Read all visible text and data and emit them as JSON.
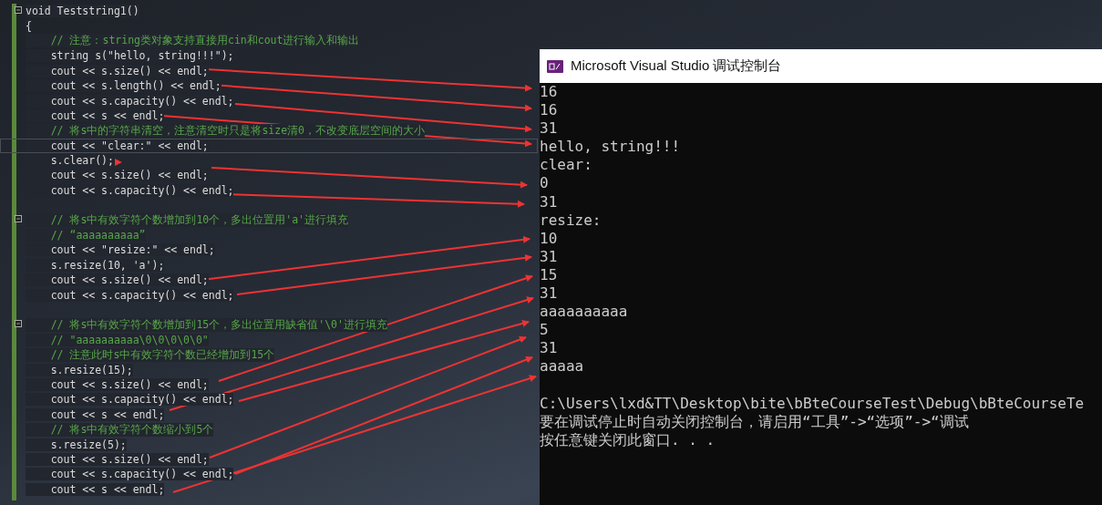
{
  "editor": {
    "lines": [
      {
        "kind": "code",
        "text": "void Teststring1()",
        "fold": true,
        "current": false
      },
      {
        "kind": "code",
        "text": "{",
        "fold": false,
        "current": false
      },
      {
        "kind": "comment",
        "text": "    // 注意：string类对象支持直接用cin和cout进行输入和输出",
        "fold": false,
        "current": false
      },
      {
        "kind": "code",
        "text": "    string s(\"hello, string!!!\");",
        "fold": false,
        "current": false
      },
      {
        "kind": "code",
        "text": "    cout << s.size() << endl;",
        "fold": false,
        "current": false
      },
      {
        "kind": "code",
        "text": "    cout << s.length() << endl;",
        "fold": false,
        "current": false
      },
      {
        "kind": "code",
        "text": "    cout << s.capacity() << endl;",
        "fold": false,
        "current": false
      },
      {
        "kind": "code",
        "text": "    cout << s << endl;",
        "fold": false,
        "current": false
      },
      {
        "kind": "comment",
        "text": "    // 将s中的字符串清空，注意清空时只是将size清0，不改变底层空间的大小",
        "fold": false,
        "current": false
      },
      {
        "kind": "code",
        "text": "    cout << \"clear:\" << endl;",
        "fold": false,
        "current": true
      },
      {
        "kind": "code",
        "text": "    s.clear();",
        "fold": false,
        "current": false
      },
      {
        "kind": "code",
        "text": "    cout << s.size() << endl;",
        "fold": false,
        "current": false
      },
      {
        "kind": "code",
        "text": "    cout << s.capacity() << endl;",
        "fold": false,
        "current": false
      },
      {
        "kind": "blank",
        "fold": false,
        "current": false
      },
      {
        "kind": "comment",
        "text": "    // 将s中有效字符个数增加到10个，多出位置用'a'进行填充",
        "fold": true,
        "current": false
      },
      {
        "kind": "comment",
        "text": "    // “aaaaaaaaaa”",
        "fold": false,
        "current": false
      },
      {
        "kind": "code",
        "text": "    cout << \"resize:\" << endl;",
        "fold": false,
        "current": false
      },
      {
        "kind": "code",
        "text": "    s.resize(10, 'a');",
        "fold": false,
        "current": false
      },
      {
        "kind": "code",
        "text": "    cout << s.size() << endl;",
        "fold": false,
        "current": false
      },
      {
        "kind": "code",
        "text": "    cout << s.capacity() << endl;",
        "fold": false,
        "current": false
      },
      {
        "kind": "blank",
        "fold": false,
        "current": false
      },
      {
        "kind": "comment",
        "text": "    // 将s中有效字符个数增加到15个，多出位置用缺省值'\\0'进行填充",
        "fold": true,
        "current": false
      },
      {
        "kind": "comment",
        "text": "    // \"aaaaaaaaaa\\0\\0\\0\\0\\0\"",
        "fold": false,
        "current": false
      },
      {
        "kind": "comment",
        "text": "    // 注意此时s中有效字符个数已经增加到15个",
        "fold": false,
        "current": false
      },
      {
        "kind": "code",
        "text": "    s.resize(15);",
        "fold": false,
        "current": false
      },
      {
        "kind": "code",
        "text": "    cout << s.size() << endl;",
        "fold": false,
        "current": false
      },
      {
        "kind": "code",
        "text": "    cout << s.capacity() << endl;",
        "fold": false,
        "current": false
      },
      {
        "kind": "code",
        "text": "    cout << s << endl;",
        "fold": false,
        "current": false
      },
      {
        "kind": "comment",
        "text": "    // 将s中有效字符个数缩小到5个",
        "fold": false,
        "current": false
      },
      {
        "kind": "code",
        "text": "    s.resize(5);",
        "fold": false,
        "current": false
      },
      {
        "kind": "code",
        "text": "    cout << s.size() << endl;",
        "fold": false,
        "current": false
      },
      {
        "kind": "code",
        "text": "    cout << s.capacity() << endl;",
        "fold": false,
        "current": false
      },
      {
        "kind": "code",
        "text": "    cout << s << endl;",
        "fold": false,
        "current": false
      }
    ]
  },
  "console": {
    "title": "Microsoft Visual Studio 调试控制台",
    "lines": [
      {
        "kind": "text",
        "text": "16"
      },
      {
        "kind": "text",
        "text": "16"
      },
      {
        "kind": "text",
        "text": "31"
      },
      {
        "kind": "text",
        "text": "hello, string!!!"
      },
      {
        "kind": "text",
        "text": "clear:"
      },
      {
        "kind": "text",
        "text": "0"
      },
      {
        "kind": "text",
        "text": "31"
      },
      {
        "kind": "text",
        "text": "resize:"
      },
      {
        "kind": "text",
        "text": "10"
      },
      {
        "kind": "text",
        "text": "31"
      },
      {
        "kind": "text",
        "text": "15"
      },
      {
        "kind": "text",
        "text": "31"
      },
      {
        "kind": "text",
        "text": "aaaaaaaaaa"
      },
      {
        "kind": "text",
        "text": "5"
      },
      {
        "kind": "text",
        "text": "31"
      },
      {
        "kind": "text",
        "text": "aaaaa"
      },
      {
        "kind": "blank"
      },
      {
        "kind": "text",
        "text": "C:\\Users\\lxd&TT\\Desktop\\bite\\bBteCourseTest\\Debug\\bBteCourseTe"
      },
      {
        "kind": "text",
        "text": "要在调试停止时自动关闭控制台，请启用“工具”->“选项”->“调试"
      },
      {
        "kind": "text",
        "text": "按任意键关闭此窗口. . ."
      }
    ]
  }
}
